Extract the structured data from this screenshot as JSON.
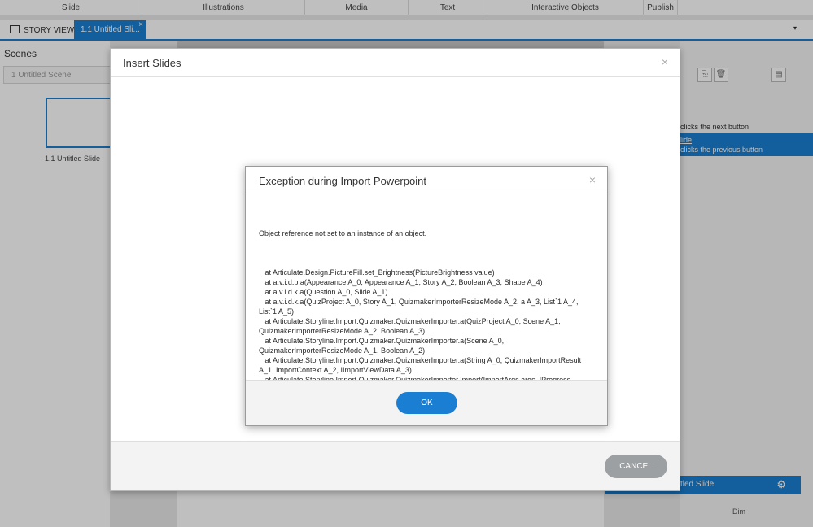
{
  "ribbon": {
    "groups": [
      "Slide",
      "Illustrations",
      "Media",
      "Text",
      "Interactive Objects",
      "Publish"
    ]
  },
  "tabs": {
    "story_view": "STORY VIEW",
    "slide_tab": "1.1 Untitled Sli...",
    "close_glyph": "×",
    "dropdown_glyph": "▾"
  },
  "scenes": {
    "title": "Scenes",
    "select_value": "1 Untitled Scene",
    "slide_label": "1.1 Untitled Slide"
  },
  "right_panel": {
    "line1": "clicks the next button",
    "line2": "lide",
    "line3": "clicks the previous button",
    "slide_bar": "tled Slide",
    "dim_label": "Dim"
  },
  "insert_dialog": {
    "title": "Insert Slides",
    "cancel": "CANCEL"
  },
  "error_dialog": {
    "title": "Exception during Import Powerpoint",
    "message": "Object reference not set to an instance of an object.",
    "stack": "   at Articulate.Design.PictureFill.set_Brightness(PictureBrightness value)\n   at a.v.i.d.b.a(Appearance A_0, Appearance A_1, Story A_2, Boolean A_3, Shape A_4)\n   at a.v.i.d.k.a(Question A_0, Slide A_1)\n   at a.v.i.d.k.a(QuizProject A_0, Story A_1, QuizmakerImporterResizeMode A_2, a A_3, List`1 A_4,\nList`1 A_5)\n   at Articulate.Storyline.Import.Quizmaker.QuizmakerImporter.a(QuizProject A_0, Scene A_1,\nQuizmakerImporterResizeMode A_2, Boolean A_3)\n   at Articulate.Storyline.Import.Quizmaker.QuizmakerImporter.a(Scene A_0,\nQuizmakerImporterResizeMode A_1, Boolean A_2)\n   at Articulate.Storyline.Import.Quizmaker.QuizmakerImporter.a(String A_0, QuizmakerImportResult\nA_1, ImportContext A_2, IImportViewData A_3)\n   at Articulate.Storyline.Import.Quizmaker.QuizmakerImporter.Import(ImportArgs args, IProgress\nimportProgress)\n   at Articulate.Storyline.Import.Common.ImportContent.Import(ImportArgs args, IProgress\nprogress)",
    "ok": "OK",
    "close_glyph": "×"
  },
  "colors": {
    "accent": "#1a7fd2",
    "cancel_button": "#9da0a3"
  }
}
